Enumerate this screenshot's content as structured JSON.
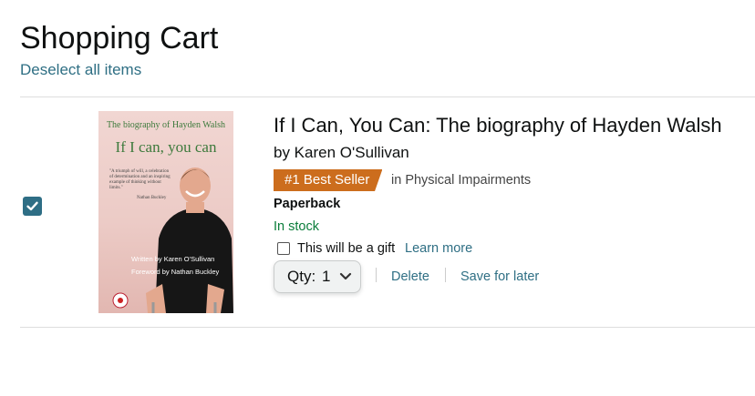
{
  "page": {
    "title": "Shopping Cart",
    "deselect_label": "Deselect all items"
  },
  "item": {
    "selected": true,
    "title": "If I Can, You Can: The biography of Hayden Walsh",
    "author": "by Karen O'Sullivan",
    "badge": "#1 Best Seller",
    "category": "in Physical Impairments",
    "format": "Paperback",
    "stock": "In stock",
    "gift_label": "This will be a gift",
    "gift_learn_more": "Learn more",
    "gift_checked": false,
    "qty_label": "Qty:",
    "qty_value": "1",
    "delete_label": "Delete",
    "save_label": "Save for later",
    "cover": {
      "subtitle": "The biography of Hayden Walsh",
      "title": "If I can, you can",
      "quote": "\"A triumph of will, a celebration of determination and an inspiring example of thinking without limits.\"",
      "quote_author": "Nathan Buckley",
      "written_by": "Written by Karen O'Sullivan",
      "foreword_by": "Foreword by Nathan Buckley"
    }
  },
  "colors": {
    "link": "#2f6f84",
    "badge": "#cc6d1d",
    "in_stock": "#0a7d3a",
    "checkbox": "#2e6e85"
  }
}
